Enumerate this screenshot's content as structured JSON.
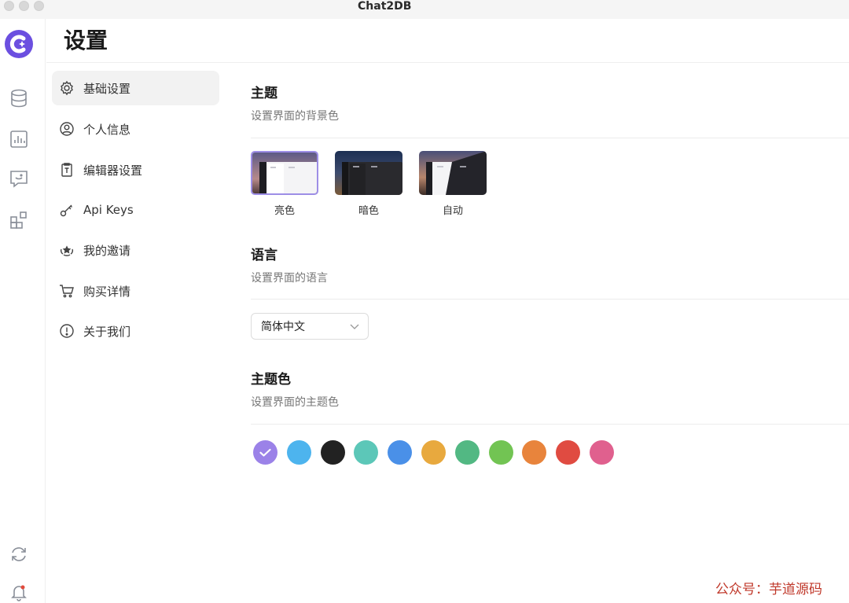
{
  "window": {
    "title": "Chat2DB"
  },
  "header": {
    "title": "设置"
  },
  "rail": {
    "icons": [
      "database-icon",
      "chart-icon",
      "chat-icon",
      "apps-icon",
      "sync-icon",
      "bell-icon"
    ],
    "accent": "#6b4fe0"
  },
  "menu": {
    "items": [
      {
        "label": "基础设置",
        "icon": "gear-icon",
        "active": true
      },
      {
        "label": "个人信息",
        "icon": "user-icon"
      },
      {
        "label": "编辑器设置",
        "icon": "editor-icon"
      },
      {
        "label": "Api Keys",
        "icon": "key-icon"
      },
      {
        "label": "我的邀请",
        "icon": "invite-icon"
      },
      {
        "label": "购买详情",
        "icon": "cart-icon"
      },
      {
        "label": "关于我们",
        "icon": "info-icon"
      }
    ]
  },
  "theme": {
    "title": "主题",
    "desc": "设置界面的背景色",
    "options": [
      {
        "label": "亮色",
        "selected": true
      },
      {
        "label": "暗色"
      },
      {
        "label": "自动"
      }
    ]
  },
  "language": {
    "title": "语言",
    "desc": "设置界面的语言",
    "selected": "简体中文"
  },
  "theme_color": {
    "title": "主题色",
    "desc": "设置界面的主题色",
    "colors": [
      "#9b82e8",
      "#4db4ee",
      "#222222",
      "#5cc7b8",
      "#4a90e8",
      "#e8a93e",
      "#52b883",
      "#72c453",
      "#e8843c",
      "#e04b41",
      "#e0608e"
    ],
    "selected_index": 0
  },
  "watermark": "公众号：芋道源码"
}
